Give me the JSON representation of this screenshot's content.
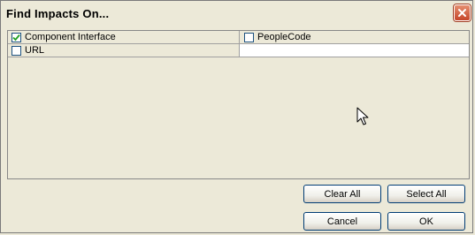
{
  "dialog": {
    "title": "Find Impacts On..."
  },
  "items": [
    {
      "label": "Component Interface",
      "checked": true
    },
    {
      "label": "PeopleCode",
      "checked": false
    },
    {
      "label": "URL",
      "checked": false
    }
  ],
  "buttons": {
    "clear_all": "Clear All",
    "select_all": "Select All",
    "cancel": "Cancel",
    "ok": "OK"
  },
  "icons": {
    "close": "close-icon",
    "checkmark": "checkmark-icon",
    "cursor": "mouse-pointer-icon"
  },
  "colors": {
    "background": "#ece9d8",
    "close_button": "#c5452a",
    "check": "#21a121",
    "button_border": "#003c74"
  }
}
